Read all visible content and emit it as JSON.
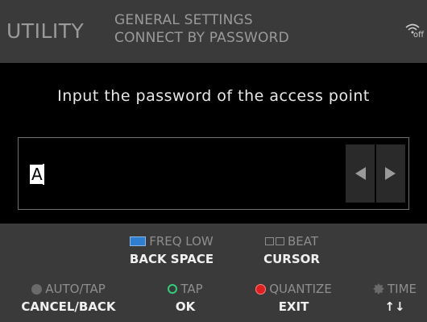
{
  "header": {
    "title": "UTILITY",
    "line1": "GENERAL SETTINGS",
    "line2": "CONNECT BY PASSWORD",
    "wifi_status": "off"
  },
  "main": {
    "prompt": "Input the password of the access point",
    "input_value": "A"
  },
  "keys": {
    "freq_top": "FREQ LOW",
    "freq_bottom": "BACK SPACE",
    "beat_top": "BEAT",
    "beat_bottom": "CURSOR",
    "auto_top": "AUTO/TAP",
    "auto_bottom": "CANCEL/BACK",
    "tap_top": "TAP",
    "tap_bottom": "OK",
    "quantize_top": "QUANTIZE",
    "quantize_bottom": "EXIT",
    "time_top": "TIME",
    "time_bottom": "↑↓"
  },
  "colors": {
    "freq_icon": "#2f7fd0",
    "tap_icon": "#2ed07a",
    "quantize_icon": "#e02020"
  }
}
